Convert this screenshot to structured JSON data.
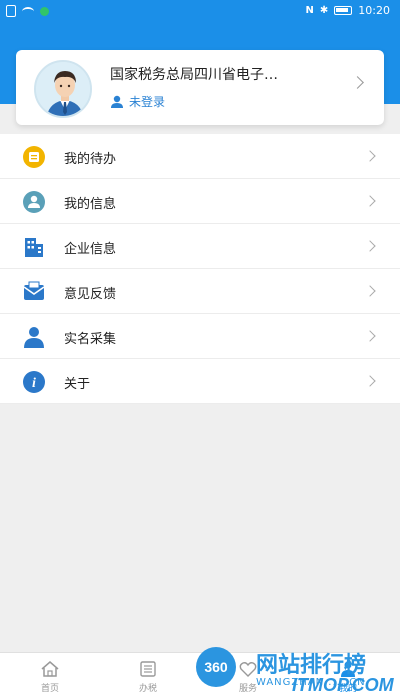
{
  "status_bar": {
    "time": "10:20"
  },
  "profile": {
    "title": "国家税务总局四川省电子…",
    "login_text": "未登录"
  },
  "menu": {
    "items": [
      {
        "label": "我的待办",
        "icon": "todo-icon"
      },
      {
        "label": "我的信息",
        "icon": "user-info-icon"
      },
      {
        "label": "企业信息",
        "icon": "building-icon"
      },
      {
        "label": "意见反馈",
        "icon": "mail-icon"
      },
      {
        "label": "实名采集",
        "icon": "person-icon"
      },
      {
        "label": "关于",
        "icon": "info-icon"
      }
    ]
  },
  "tabbar": {
    "tabs": [
      {
        "label": "首页"
      },
      {
        "label": "办税"
      },
      {
        "label": "服务"
      },
      {
        "label": "我的"
      }
    ]
  },
  "watermark": {
    "badge": "360",
    "text": "网站排行榜",
    "brand": "ITMOP.COM",
    "sub": "WANGZHAN......CN"
  },
  "colors": {
    "primary": "#1b8fe8",
    "link": "#2a82d3",
    "background": "#efefef"
  }
}
